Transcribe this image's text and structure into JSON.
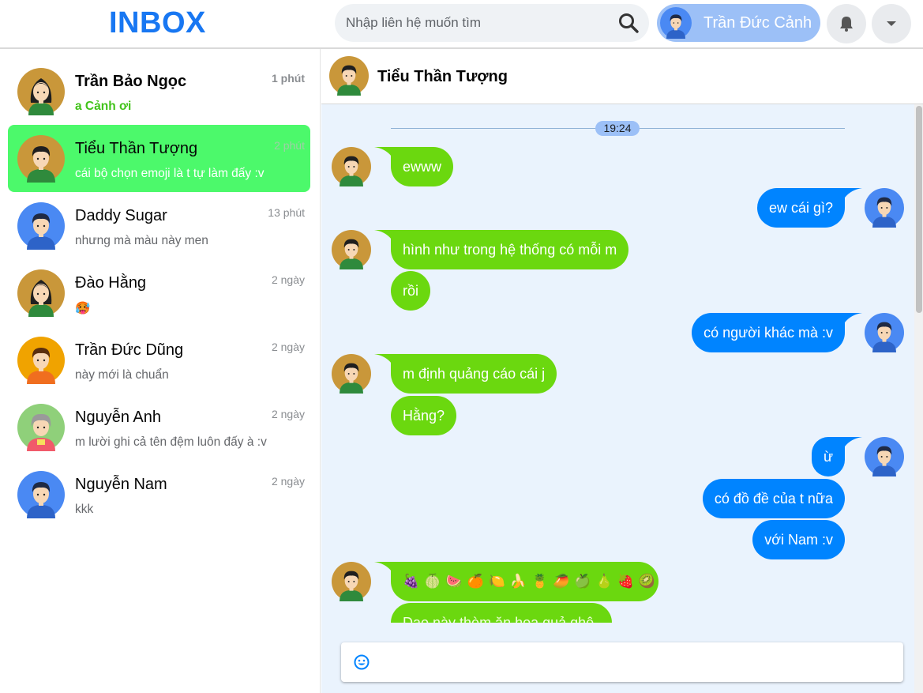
{
  "header": {
    "logo": "INBOX",
    "search_placeholder": "Nhập liên hệ muốn tìm",
    "search_icon": "search-icon",
    "current_user": "Trần Đức Cảnh",
    "bell_icon": "bell-icon",
    "menu_icon": "caret-down-icon"
  },
  "conversations": [
    {
      "name": "Trần Bảo Ngọc",
      "preview": "a Cảnh ơi",
      "time": "1 phút",
      "avatar": "girl-avatar",
      "unread": true,
      "active": false
    },
    {
      "name": "Tiểu Thần Tượng",
      "preview": "cái bộ chọn emoji là t tự làm đấy :v",
      "time": "2 phút",
      "avatar": "boy-green-avatar",
      "unread": false,
      "active": true
    },
    {
      "name": "Daddy Sugar",
      "preview": "nhưng mà màu này men",
      "time": "13 phút",
      "avatar": "boy-blue-avatar",
      "unread": false,
      "active": false
    },
    {
      "name": "Đào Hằng",
      "preview": "🥵",
      "time": "2 ngày",
      "avatar": "girl-avatar",
      "unread": false,
      "active": false
    },
    {
      "name": "Trần Đức Dũng",
      "preview": "này mới là chuẩn",
      "time": "2 ngày",
      "avatar": "boy-orange-avatar",
      "unread": false,
      "active": false
    },
    {
      "name": "Nguyễn Anh",
      "preview": "m lười ghi cả tên đệm luôn đấy à :v",
      "time": "2 ngày",
      "avatar": "elder-avatar",
      "unread": false,
      "active": false
    },
    {
      "name": "Nguyễn Nam",
      "preview": "kkk",
      "time": "2 ngày",
      "avatar": "boy-blue-avatar",
      "unread": false,
      "active": false
    }
  ],
  "chat": {
    "title": "Tiểu Thần Tượng",
    "time_divider": "19:24",
    "messages": [
      {
        "from": "them",
        "text": "ewww"
      },
      {
        "from": "me",
        "text": "ew cái gì?"
      },
      {
        "from": "them",
        "text": "hình như trong hệ thống có mỗi m"
      },
      {
        "from": "them",
        "text": "rồi"
      },
      {
        "from": "me",
        "text": "có người khác mà :v"
      },
      {
        "from": "them",
        "text": "m định quảng cáo cái j"
      },
      {
        "from": "them",
        "text": "Hằng?"
      },
      {
        "from": "me",
        "text": "ừ"
      },
      {
        "from": "me",
        "text": "có đồ đề của t nữa"
      },
      {
        "from": "me",
        "text": "với Nam :v"
      },
      {
        "from": "them",
        "text": "🍇🍈🍉🍊🍋🍌🍍🥭🍏🍐🍓🥝"
      },
      {
        "from": "them",
        "text": "Dạo này thèm ăn hoa quả ghê"
      }
    ],
    "emoji_row": [
      "🍇",
      "🍈",
      "🍉",
      "🍊",
      "🍋",
      "🍌",
      "🍍",
      "🥭",
      "🍏",
      "🍐",
      "🍓",
      "🥝"
    ],
    "composer_icon": "smile-icon",
    "composer_placeholder": ""
  },
  "colors": {
    "brand": "#1877f2",
    "incoming_bubble": "#6bd80f",
    "outgoing_bubble": "#0084ff",
    "active_conversation": "#4cf96b",
    "chat_background": "#eaf3fd"
  }
}
